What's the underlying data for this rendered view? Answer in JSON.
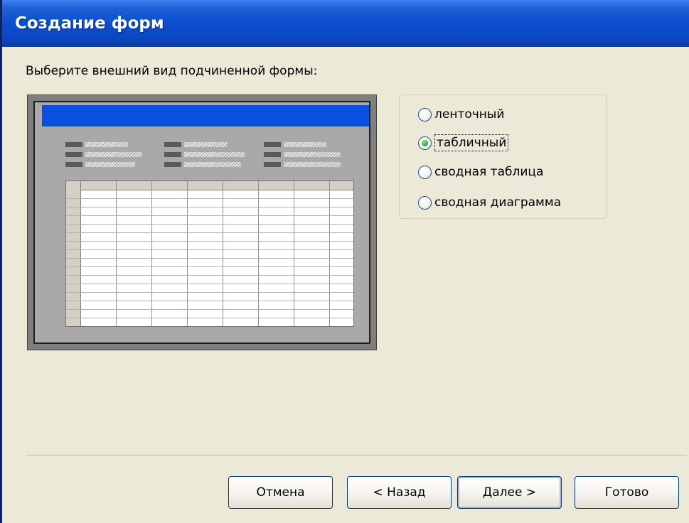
{
  "window": {
    "title": "Создание форм"
  },
  "prompt": "Выберите внешний вид подчиненной формы:",
  "options": [
    {
      "label": "ленточный",
      "accesskey": "л",
      "checked": false
    },
    {
      "label": "табличный",
      "accesskey": "т",
      "checked": true
    },
    {
      "label": "сводная таблица",
      "accesskey": "с",
      "checked": false
    },
    {
      "label": "сводная диаграмма",
      "accesskey": "и",
      "checked": false
    }
  ],
  "buttons": {
    "cancel": "Отмена",
    "back": "< Назад",
    "next": "Далее >",
    "finish": "Готово"
  },
  "colors": {
    "titlebar": "#0A4FCF",
    "dialog_bg": "#ECE9D8",
    "preview_titlebar": "#0A50E0",
    "radio_selected": "#2FB52F"
  }
}
